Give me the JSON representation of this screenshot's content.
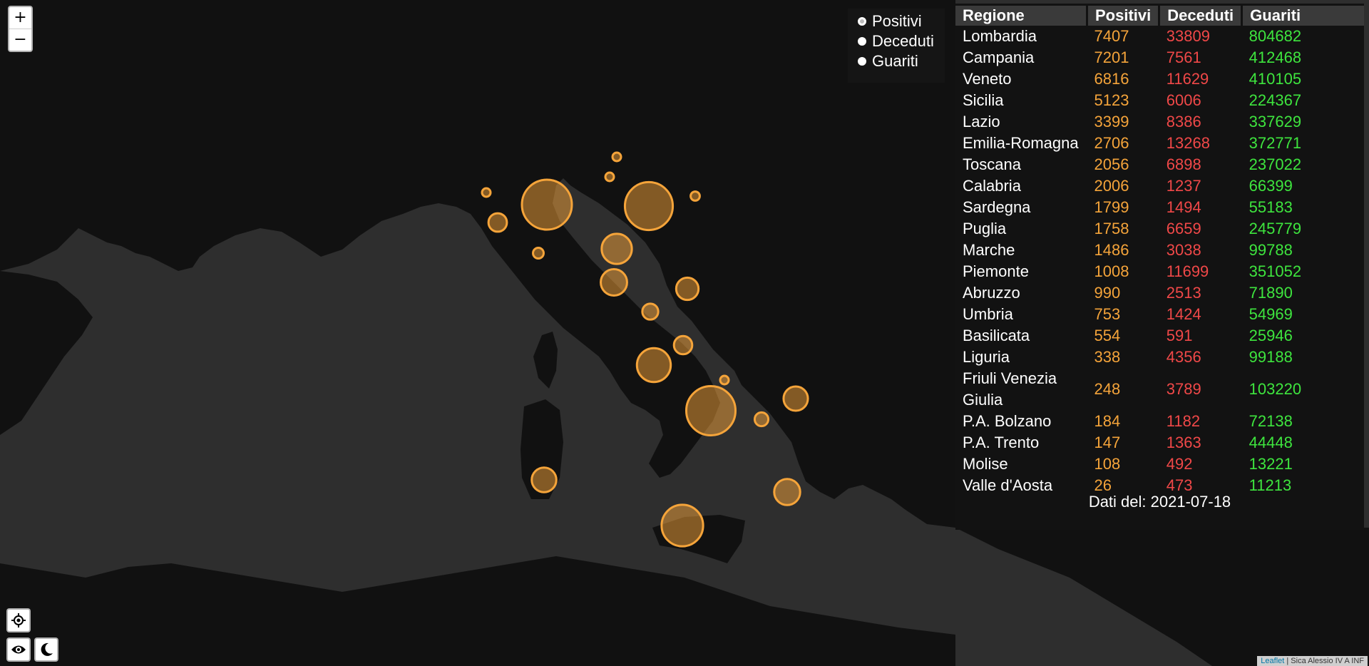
{
  "map": {
    "circles": [
      {
        "region": "Lombardia",
        "value": 7407
      },
      {
        "region": "Campania",
        "value": 7201
      },
      {
        "region": "Veneto",
        "value": 6816
      },
      {
        "region": "Sicilia",
        "value": 5123
      },
      {
        "region": "Lazio",
        "value": 3399
      },
      {
        "region": "Emilia-Romagna",
        "value": 2706
      },
      {
        "region": "Toscana",
        "value": 2056
      },
      {
        "region": "Calabria",
        "value": 2006
      },
      {
        "region": "Sardegna",
        "value": 1799
      },
      {
        "region": "Puglia",
        "value": 1758
      },
      {
        "region": "Marche",
        "value": 1486
      },
      {
        "region": "Piemonte",
        "value": 1008
      },
      {
        "region": "Abruzzo",
        "value": 990
      },
      {
        "region": "Umbria",
        "value": 753
      },
      {
        "region": "Basilicata",
        "value": 554
      },
      {
        "region": "Liguria",
        "value": 338
      },
      {
        "region": "Friuli Venezia Giulia",
        "value": 248
      },
      {
        "region": "P.A. Bolzano",
        "value": 184
      },
      {
        "region": "P.A. Trento",
        "value": 147
      },
      {
        "region": "Molise",
        "value": 108
      },
      {
        "region": "Valle d'Aosta",
        "value": 26
      }
    ],
    "circle_color": "#f5a43a",
    "sea_color": "#2e2e2e",
    "land_color": "#111111"
  },
  "zoom": {
    "in": "+",
    "out": "−"
  },
  "layers": {
    "items": [
      {
        "label": "Positivi",
        "checked": true
      },
      {
        "label": "Deceduti",
        "checked": false
      },
      {
        "label": "Guariti",
        "checked": false
      }
    ]
  },
  "table": {
    "headers": {
      "region": "Regione",
      "pos": "Positivi",
      "dec": "Deceduti",
      "gua": "Guariti"
    },
    "rows": [
      {
        "region": "Lombardia",
        "pos": "7407",
        "dec": "33809",
        "gua": "804682"
      },
      {
        "region": "Campania",
        "pos": "7201",
        "dec": "7561",
        "gua": "412468"
      },
      {
        "region": "Veneto",
        "pos": "6816",
        "dec": "11629",
        "gua": "410105"
      },
      {
        "region": "Sicilia",
        "pos": "5123",
        "dec": "6006",
        "gua": "224367"
      },
      {
        "region": "Lazio",
        "pos": "3399",
        "dec": "8386",
        "gua": "337629"
      },
      {
        "region": "Emilia-Romagna",
        "pos": "2706",
        "dec": "13268",
        "gua": "372771"
      },
      {
        "region": "Toscana",
        "pos": "2056",
        "dec": "6898",
        "gua": "237022"
      },
      {
        "region": "Calabria",
        "pos": "2006",
        "dec": "1237",
        "gua": "66399"
      },
      {
        "region": "Sardegna",
        "pos": "1799",
        "dec": "1494",
        "gua": "55183"
      },
      {
        "region": "Puglia",
        "pos": "1758",
        "dec": "6659",
        "gua": "245779"
      },
      {
        "region": "Marche",
        "pos": "1486",
        "dec": "3038",
        "gua": "99788"
      },
      {
        "region": "Piemonte",
        "pos": "1008",
        "dec": "11699",
        "gua": "351052"
      },
      {
        "region": "Abruzzo",
        "pos": "990",
        "dec": "2513",
        "gua": "71890"
      },
      {
        "region": "Umbria",
        "pos": "753",
        "dec": "1424",
        "gua": "54969"
      },
      {
        "region": "Basilicata",
        "pos": "554",
        "dec": "591",
        "gua": "25946"
      },
      {
        "region": "Liguria",
        "pos": "338",
        "dec": "4356",
        "gua": "99188"
      },
      {
        "region": "Friuli Venezia Giulia",
        "pos": "248",
        "dec": "3789",
        "gua": "103220"
      },
      {
        "region": "P.A. Bolzano",
        "pos": "184",
        "dec": "1182",
        "gua": "72138"
      },
      {
        "region": "P.A. Trento",
        "pos": "147",
        "dec": "1363",
        "gua": "44448"
      },
      {
        "region": "Molise",
        "pos": "108",
        "dec": "492",
        "gua": "13221"
      },
      {
        "region": "Valle d'Aosta",
        "pos": "26",
        "dec": "473",
        "gua": "11213"
      }
    ],
    "colors": {
      "pos": "#f5a43a",
      "dec": "#f04848",
      "gua": "#3ee53e"
    }
  },
  "date_text": "Dati del: 2021-07-18",
  "controls": {
    "locate": "locate-icon",
    "view": "eye-icon",
    "theme": "moon-icon"
  },
  "attribution": {
    "link": "Leaflet",
    "text": " | Sica Alessio IV A INF"
  }
}
